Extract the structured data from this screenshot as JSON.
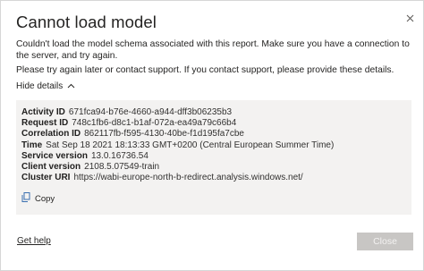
{
  "dialog": {
    "title": "Cannot load model",
    "message": "Couldn't load the model schema associated with this report. Make sure you have a connection to the server, and try again.",
    "support_message": "Please try again later or contact support. If you contact support, please provide these details.",
    "toggle_label": "Hide details",
    "details": [
      {
        "key": "Activity ID",
        "value": "671fca94-b76e-4660-a944-dff3b06235b3"
      },
      {
        "key": "Request ID",
        "value": "748c1fb6-d8c1-b1af-072a-ea49a79c66b4"
      },
      {
        "key": "Correlation ID",
        "value": "862117fb-f595-4130-40be-f1d195fa7cbe"
      },
      {
        "key": "Time",
        "value": "Sat Sep 18 2021 18:13:33 GMT+0200 (Central European Summer Time)"
      },
      {
        "key": "Service version",
        "value": "13.0.16736.54"
      },
      {
        "key": "Client version",
        "value": "2108.5.07549-train"
      },
      {
        "key": "Cluster URI",
        "value": "https://wabi-europe-north-b-redirect.analysis.windows.net/"
      }
    ],
    "copy_label": "Copy",
    "get_help_label": "Get help",
    "close_label": "Close"
  },
  "colors": {
    "details_bg": "#f3f2f1",
    "close_button_bg": "#c8c6c4",
    "text": "#252423"
  }
}
